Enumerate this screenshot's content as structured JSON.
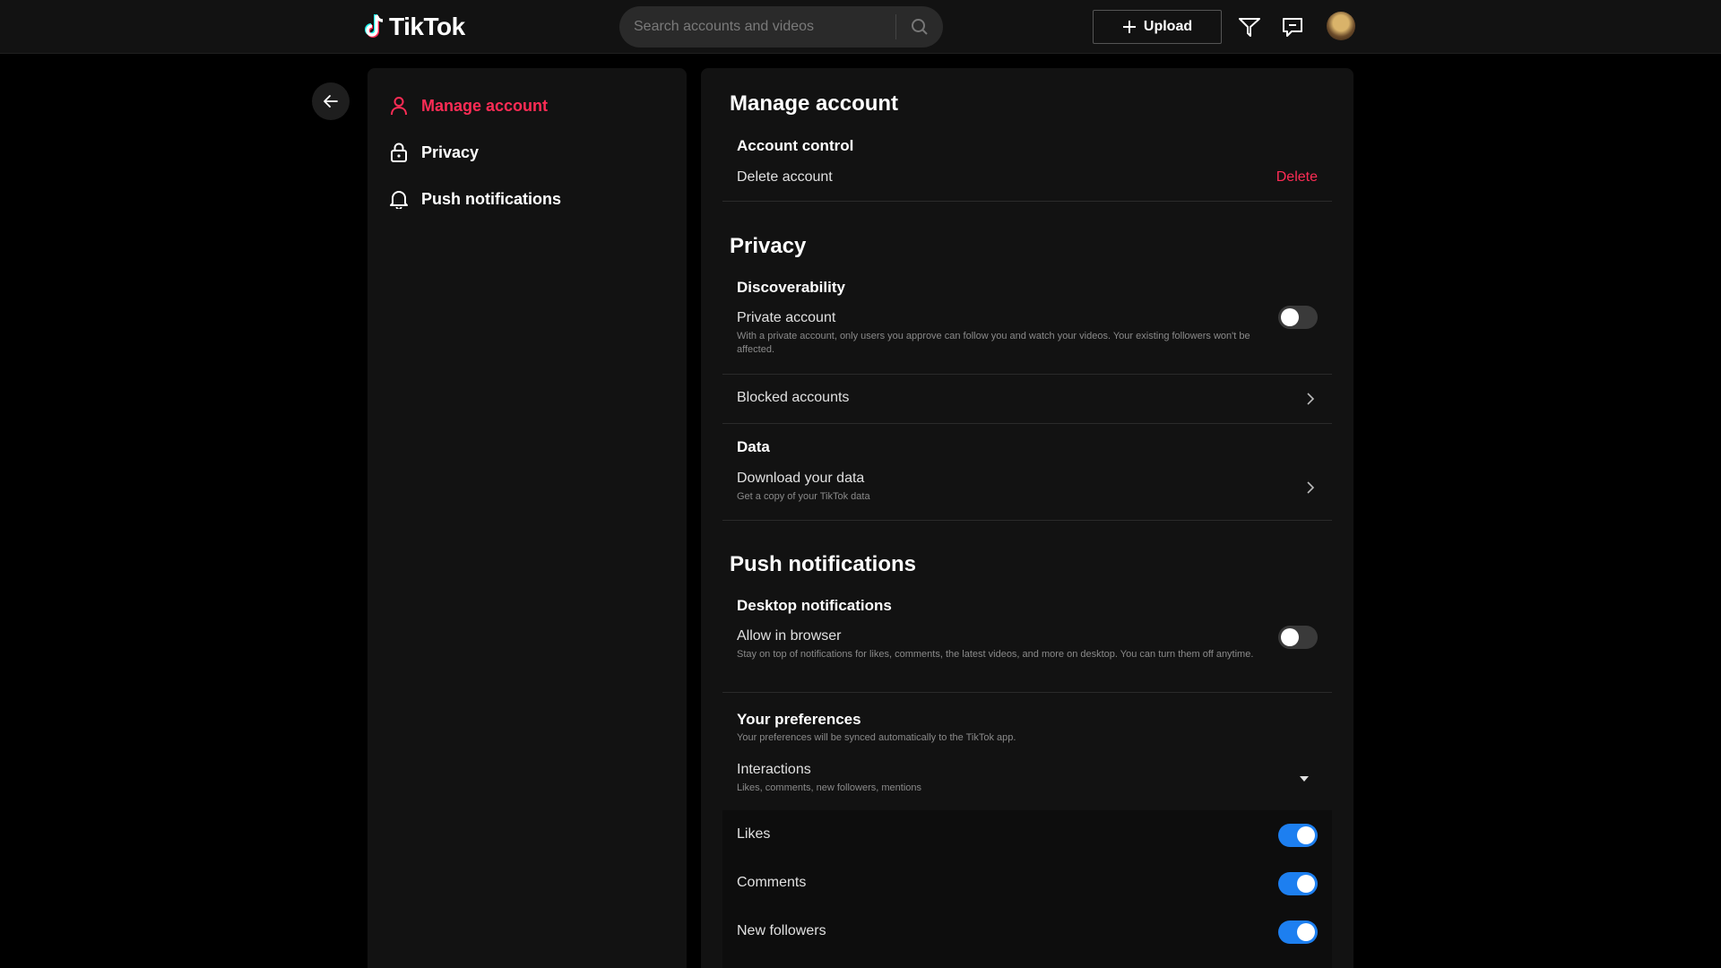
{
  "header": {
    "logo_text": "TikTok",
    "search_placeholder": "Search accounts and videos",
    "upload_label": "Upload"
  },
  "icons": {
    "logo": "tiktok-logo-icon",
    "search": "search-icon",
    "upload": "plus-icon",
    "inbox": "send-icon",
    "messages": "message-icon",
    "back": "arrow-left-icon",
    "manage": "person-icon",
    "privacy": "lock-icon",
    "push": "bell-icon"
  },
  "colors": {
    "accent": "#fe2c55",
    "toggle_on": "#1d7ff0",
    "toggle_off": "#3a3a3a"
  },
  "sidebar": {
    "items": [
      {
        "label": "Manage account",
        "active": true
      },
      {
        "label": "Privacy",
        "active": false
      },
      {
        "label": "Push notifications",
        "active": false
      }
    ]
  },
  "main": {
    "manage_account": {
      "title": "Manage account",
      "account_control": "Account control",
      "delete_account": "Delete account",
      "delete_link": "Delete"
    },
    "privacy": {
      "title": "Privacy",
      "discoverability": "Discoverability",
      "private_account": "Private account",
      "private_account_desc": "With a private account, only users you approve can follow you and watch your videos. Your existing followers won't be affected.",
      "private_account_on": false,
      "blocked_accounts": "Blocked accounts",
      "data": "Data",
      "download_data": "Download your data",
      "download_data_desc": "Get a copy of your TikTok data"
    },
    "push": {
      "title": "Push notifications",
      "desktop_notifications": "Desktop notifications",
      "allow_in_browser": "Allow in browser",
      "allow_in_browser_desc": "Stay on top of notifications for likes, comments, the latest videos, and more on desktop. You can turn them off anytime.",
      "allow_in_browser_on": false,
      "your_preferences": "Your preferences",
      "your_preferences_desc": "Your preferences will be synced automatically to the TikTok app.",
      "interactions": "Interactions",
      "interactions_desc": "Likes, comments, new followers, mentions",
      "toggles": [
        {
          "label": "Likes",
          "on": true
        },
        {
          "label": "Comments",
          "on": true
        },
        {
          "label": "New followers",
          "on": true
        }
      ]
    }
  }
}
